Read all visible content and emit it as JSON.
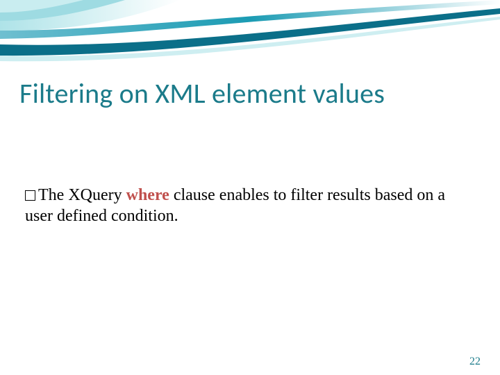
{
  "slide": {
    "title": "Filtering on XML element values",
    "bullet_pre": "The XQuery ",
    "bullet_keyword": "where",
    "bullet_post": " clause enables  to filter results based on a user defined condition.",
    "page_number": "22"
  },
  "theme": {
    "title_color": "#1b7b8a",
    "keyword_color": "#c0504d",
    "swoosh_light": "#aee3e8",
    "swoosh_dark": "#0b6f89"
  }
}
